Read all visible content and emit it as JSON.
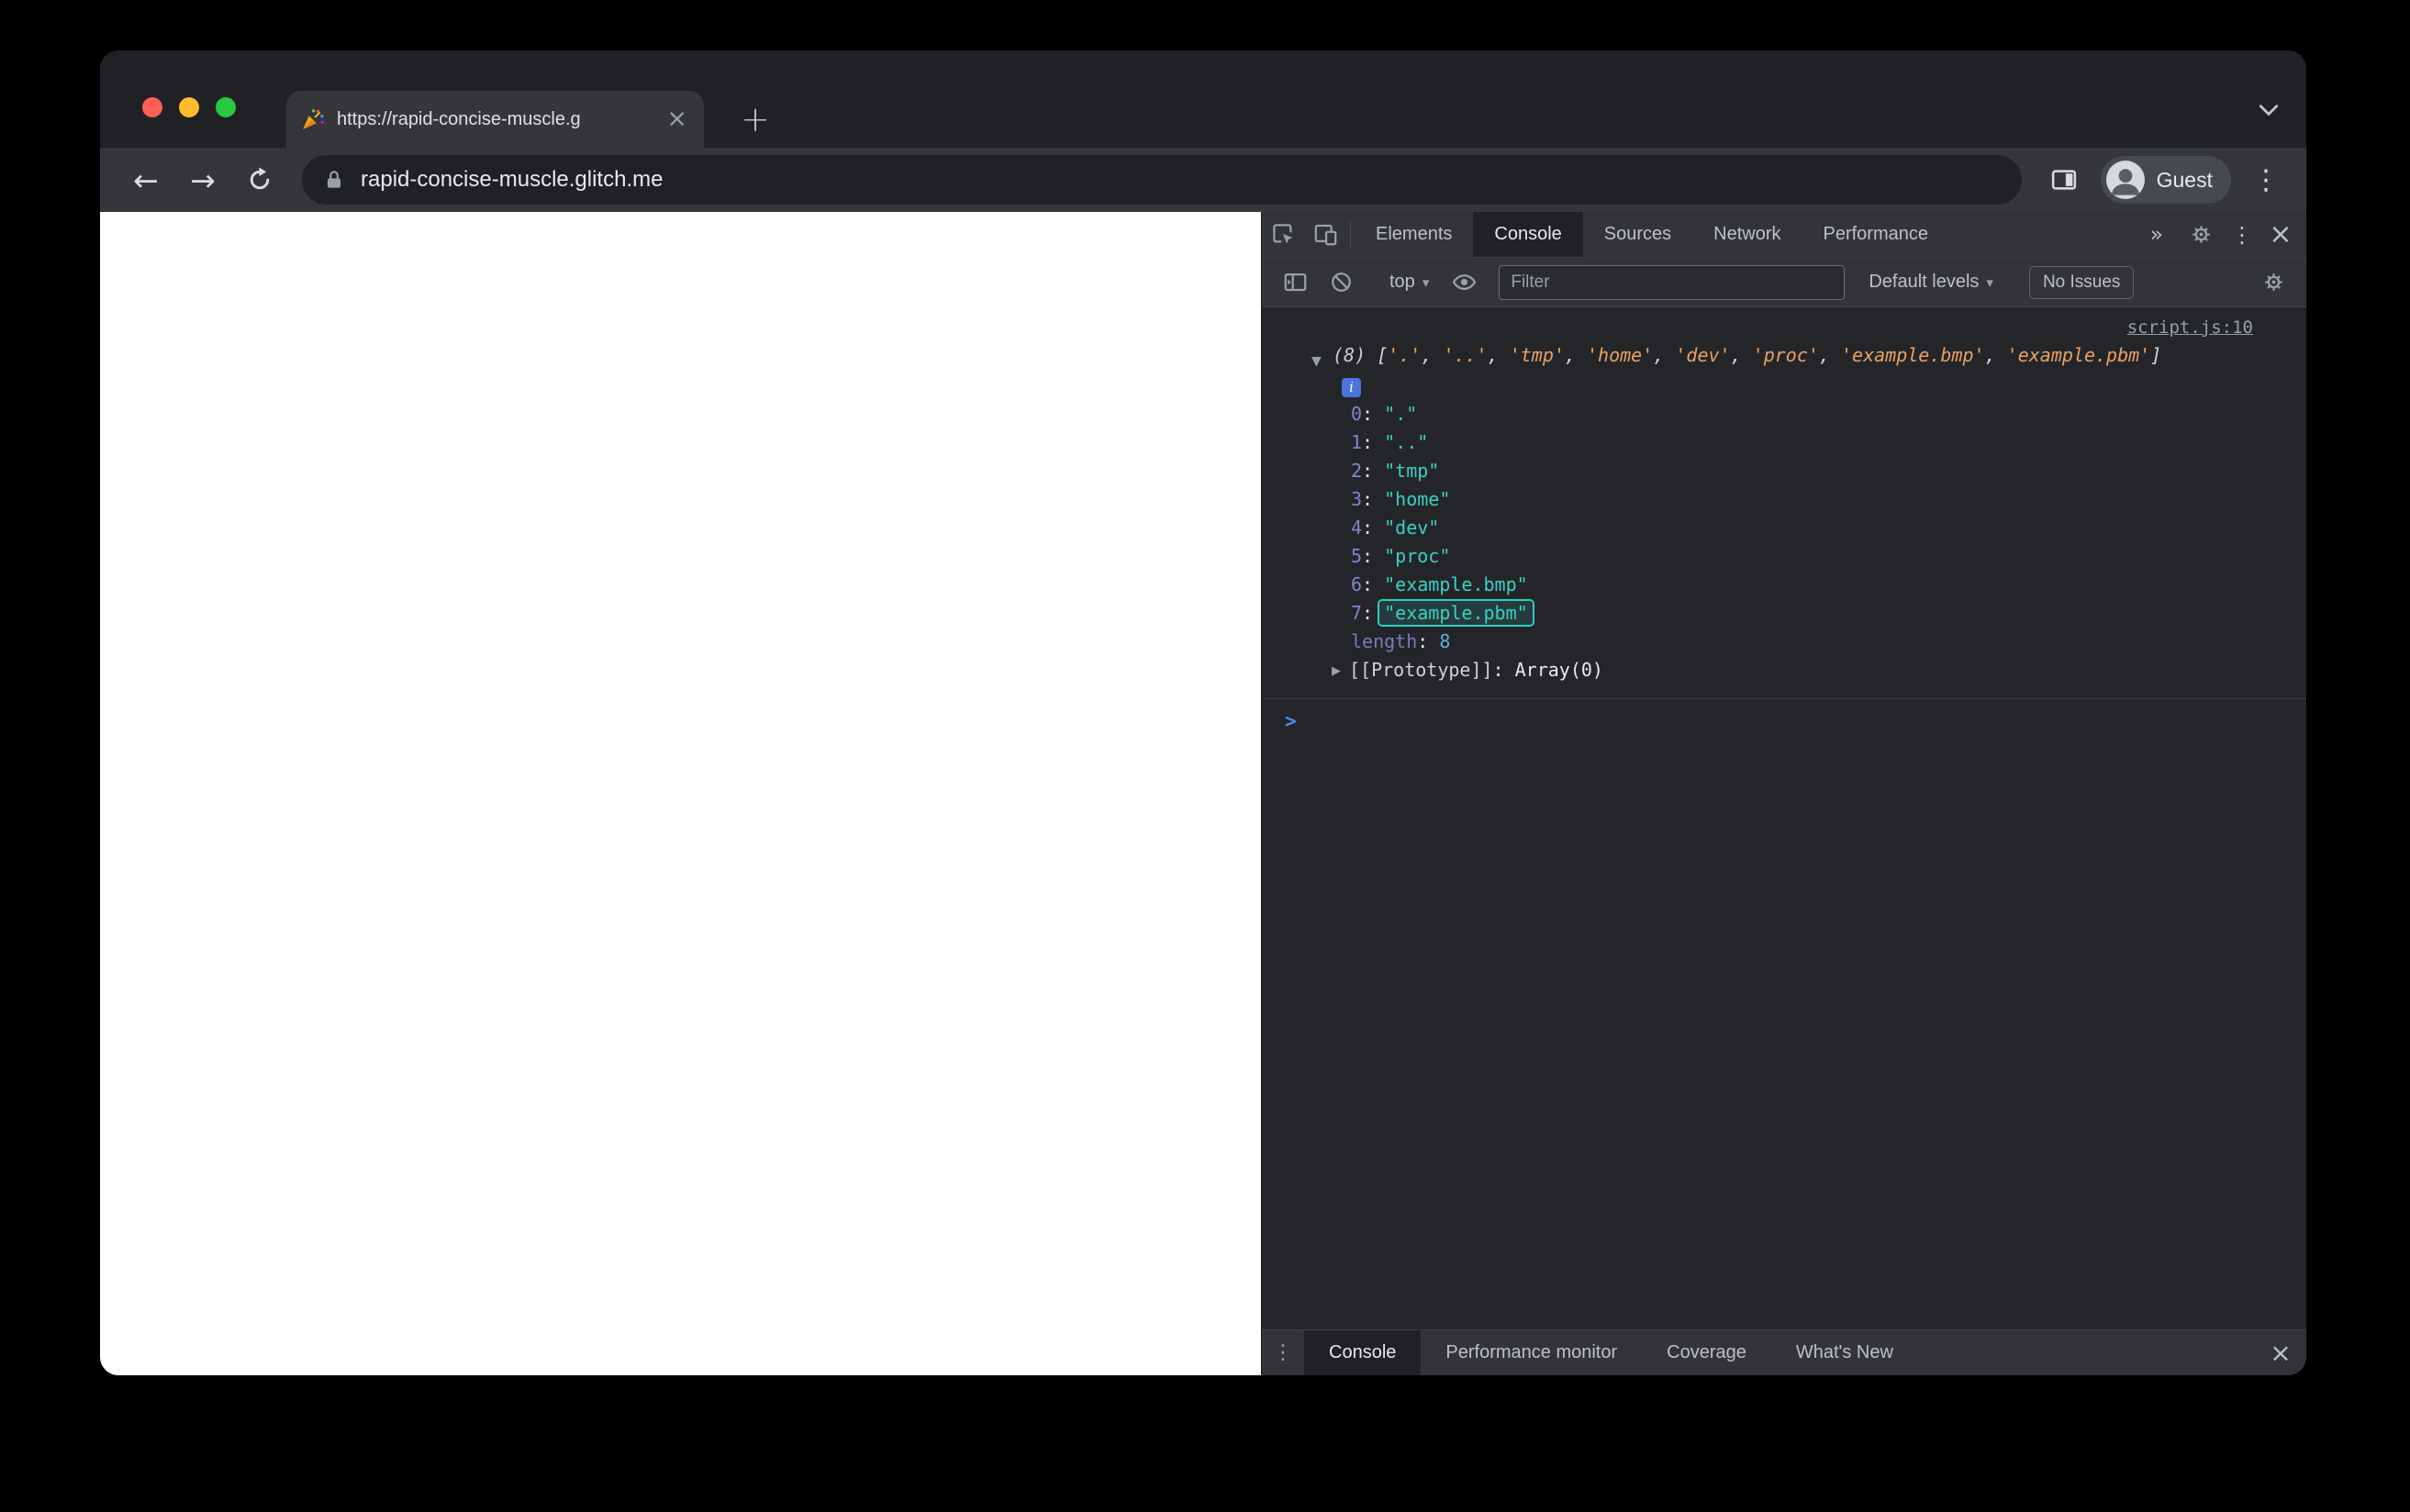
{
  "browser": {
    "tab": {
      "favicon_icon": "party-popper-icon",
      "title": "https://rapid-concise-muscle.g",
      "close_glyph": "×"
    },
    "new_tab_glyph": "+",
    "nav": {
      "back_glyph": "←",
      "forward_glyph": "→"
    },
    "omnibox": {
      "url": "rapid-concise-muscle.glitch.me"
    },
    "profile_label": "Guest",
    "menu_glyph": "⋮"
  },
  "devtools": {
    "tabbar": {
      "tabs": [
        "Elements",
        "Console",
        "Sources",
        "Network",
        "Performance"
      ],
      "active": "Console",
      "more_glyph": "»",
      "menu_glyph": "⋮",
      "close_glyph": "×"
    },
    "toolbar": {
      "context_label": "top",
      "dropdown_glyph": "▾",
      "filter_placeholder": "Filter",
      "levels_label": "Default levels",
      "issues_label": "No Issues"
    },
    "console": {
      "source_link": "script.js:10",
      "expand_glyph": "▼",
      "collapsed_glyph": "▶",
      "count": "(8)",
      "items": [
        ".",
        "..",
        "tmp",
        "home",
        "dev",
        "proc",
        "example.bmp",
        "example.pbm"
      ],
      "highlighted_index": 7,
      "colon": ": ",
      "info_glyph": "i",
      "length_label": "length",
      "length_value": "8",
      "prototype_label": "[[Prototype]]",
      "prototype_value": "Array(0)",
      "prompt_glyph": ">"
    },
    "drawer": {
      "menu_glyph": "⋮",
      "tabs": [
        "Console",
        "Performance monitor",
        "Coverage",
        "What's New"
      ],
      "active": "Console",
      "close_glyph": "×"
    }
  },
  "colors": {
    "traffic_red": "#ff5f57",
    "traffic_yellow": "#febc2e",
    "traffic_green": "#28c840",
    "string_preview": "#e8a266",
    "string_value": "#3ad1c5",
    "property_key": "#7e86cc",
    "number_value": "#5db0d7",
    "link": "#9aa0a6",
    "prompt": "#4a8cf7",
    "highlight_border": "#2dd0c2",
    "info_badge": "#4a73dd"
  }
}
